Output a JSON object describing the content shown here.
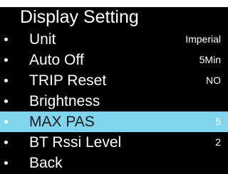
{
  "screen": {
    "title": "Display Setting",
    "background_color": "#000000",
    "highlight_color": "#7fd4ee",
    "menu": [
      {
        "label": "Unit",
        "value": "Imperial",
        "selected": false
      },
      {
        "label": "Auto Off",
        "value": "5Min",
        "selected": false
      },
      {
        "label": "TRIP Reset",
        "value": "NO",
        "selected": false
      },
      {
        "label": "Brightness",
        "value": "",
        "selected": false
      },
      {
        "label": "MAX PAS",
        "value": "5",
        "selected": true
      },
      {
        "label": "BT Rssi Level",
        "value": "2",
        "selected": false
      },
      {
        "label": "Back",
        "value": "",
        "selected": false
      }
    ]
  }
}
